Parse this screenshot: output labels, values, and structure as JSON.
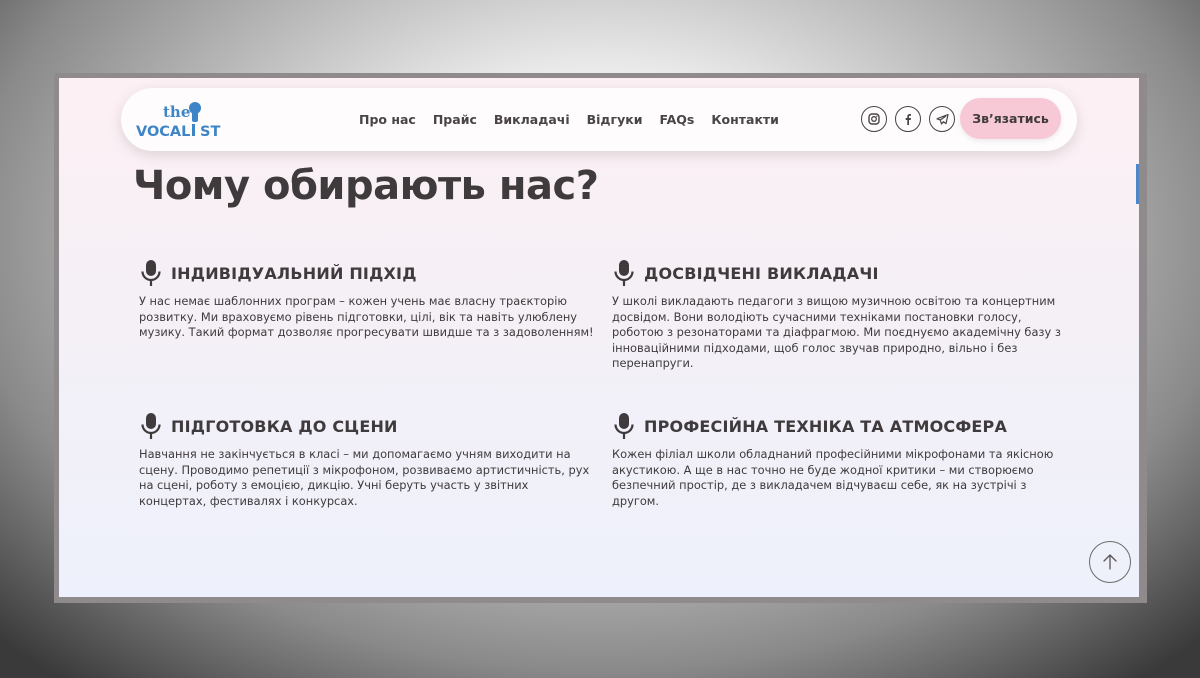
{
  "logo": {
    "top": "the",
    "bottom": "VOCAL",
    "suffix": "ST"
  },
  "nav": [
    "Про нас",
    "Прайс",
    "Викладачі",
    "Відгуки",
    "FAQs",
    "Контакти"
  ],
  "social": [
    {
      "icon": "instagram-icon"
    },
    {
      "icon": "facebook-icon"
    },
    {
      "icon": "telegram-icon"
    }
  ],
  "cta_label": "Зв’язатись",
  "title": "Чому обирають нас?",
  "features": [
    {
      "title": "ІНДИВІДУАЛЬНИЙ ПІДХІД",
      "text": "У нас немає шаблонних програм – кожен учень має власну траєкторію розвитку. Ми враховуємо рівень підготовки, цілі, вік та навіть улюблену музику. Такий формат дозволяє прогресувати швидше та з задоволенням!"
    },
    {
      "title": "ДОСВІДЧЕНІ ВИКЛАДАЧІ",
      "text": "У школі викладають педагоги з вищою музичною освітою та концертним досвідом. Вони володіють сучасними техніками постановки голосу, роботою з резонаторами та діафрагмою. Ми поєднуємо академічну базу з інноваційними підходами, щоб голос звучав природно, вільно і без перенапруги."
    },
    {
      "title": "ПІДГОТОВКА ДО СЦЕНИ",
      "text": "Навчання не закінчується в класі – ми допомагаємо учням виходити на сцену. Проводимо репетиції з мікрофоном, розвиваємо артистичність, рух на сцені, роботу з емоцією, дикцію. Учні беруть участь у звітних концертах, фестивалях і конкурсах."
    },
    {
      "title": "ПРОФЕСІЙНА ТЕХНІКА ТА АТМОСФЕРА",
      "text": "Кожен філіал школи обладнаний професійними мікрофонами та якісною акустикою. А ще в нас точно не буде жодної критики – ми створюємо безпечний простір, де з викладачем відчуваєш себе, як на зустрічі з другом."
    }
  ],
  "colors": {
    "brand_blue": "#3d85c6",
    "accent_pink": "#f7c8d6",
    "text": "#3f3a3c"
  }
}
